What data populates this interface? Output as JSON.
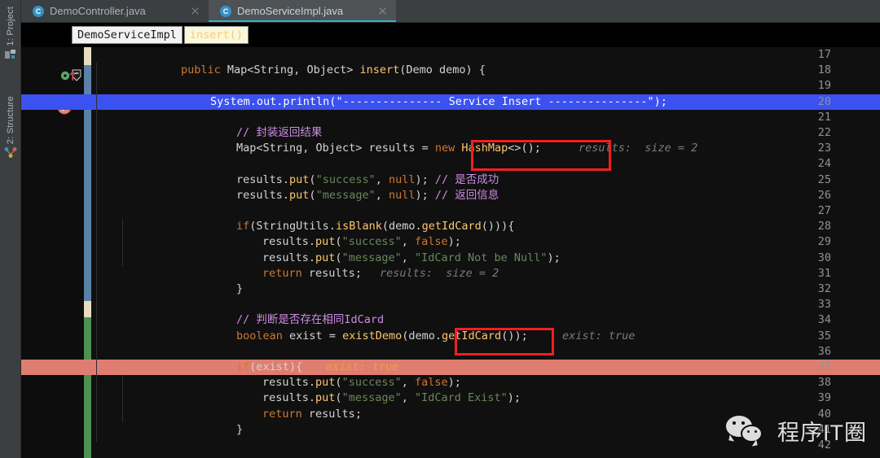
{
  "window": {
    "theme_background": "#101010",
    "accent": "#36b1c8"
  },
  "toolstrip": {
    "items": [
      {
        "label": "1: Project",
        "icon": "project-icon"
      },
      {
        "label": "2: Structure",
        "icon": "structure-icon"
      }
    ]
  },
  "tabs": [
    {
      "label": "DemoController.java",
      "icon": "java-class-icon",
      "active": false,
      "close": "×"
    },
    {
      "label": "DemoServiceImpl.java",
      "icon": "java-class-icon",
      "active": true,
      "close": "×"
    }
  ],
  "breadcrumbs": [
    {
      "label": "DemoServiceImpl",
      "kind": "class"
    },
    {
      "label": "insert()",
      "kind": "method"
    }
  ],
  "editor": {
    "first_line": 17,
    "last_line": 42,
    "highlight_colors": {
      "execution_line": "#3b51f0",
      "exception_line": "#e07d71",
      "annotation_box": "#ef2020"
    },
    "gutter_markers": [
      {
        "line": 18,
        "icon": "implementing-method-icon",
        "color": "#59a869"
      },
      {
        "line": 20,
        "icon": "breakpoint-verified-icon",
        "color": "#db5860"
      }
    ],
    "lines": [
      {
        "n": 17,
        "code": ""
      },
      {
        "n": 18,
        "code": "    public Map<String, Object> insert(Demo demo) {"
      },
      {
        "n": 19,
        "code": ""
      },
      {
        "n": 20,
        "code": "        System.out.println(\"--------------- Service Insert ---------------\");",
        "highlight": "execution"
      },
      {
        "n": 21,
        "code": ""
      },
      {
        "n": 22,
        "code": "        // 封装返回结果"
      },
      {
        "n": 23,
        "code": "        Map<String, Object> results = new HashMap<>();",
        "inline_hint": "results:  size = 2"
      },
      {
        "n": 24,
        "code": ""
      },
      {
        "n": 25,
        "code": "        results.put(\"success\", null); // 是否成功"
      },
      {
        "n": 26,
        "code": "        results.put(\"message\", null); // 返回信息"
      },
      {
        "n": 27,
        "code": ""
      },
      {
        "n": 28,
        "code": "        if(StringUtils.isBlank(demo.getIdCard())){"
      },
      {
        "n": 29,
        "code": "            results.put(\"success\", false);"
      },
      {
        "n": 30,
        "code": "            results.put(\"message\", \"IdCard Not be Null\");"
      },
      {
        "n": 31,
        "code": "            return results;",
        "inline_hint": "results:  size = 2"
      },
      {
        "n": 32,
        "code": "        }"
      },
      {
        "n": 33,
        "code": ""
      },
      {
        "n": 34,
        "code": "        // 判断是否存在相同IdCard"
      },
      {
        "n": 35,
        "code": "        boolean exist = existDemo(demo.getIdCard());",
        "inline_hint": "exist: true"
      },
      {
        "n": 36,
        "code": ""
      },
      {
        "n": 37,
        "code": "        if(exist){",
        "highlight": "exception",
        "inline_hint": "exist: true"
      },
      {
        "n": 38,
        "code": "            results.put(\"success\", false);"
      },
      {
        "n": 39,
        "code": "            results.put(\"message\", \"IdCard Exist\");"
      },
      {
        "n": 40,
        "code": "            return results;"
      },
      {
        "n": 41,
        "code": "        }"
      },
      {
        "n": 42,
        "code": ""
      }
    ],
    "annotations": [
      {
        "target_hint": "results:  size = 2",
        "line": 23
      },
      {
        "target_hint": "exist: true",
        "line": 35
      }
    ]
  },
  "watermark": {
    "text": "程序IT圈",
    "icon": "wechat-icon"
  }
}
